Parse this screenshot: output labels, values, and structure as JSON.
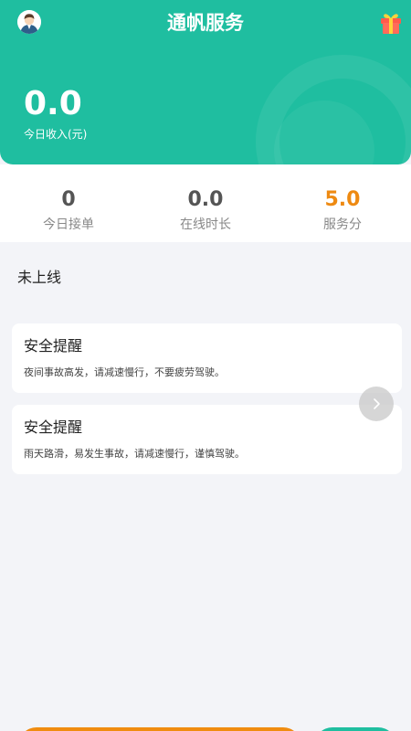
{
  "header": {
    "title": "通帆服务",
    "avatar_icon": "user-avatar-icon",
    "gift_icon": "gift-icon",
    "accent_color": "#1fbea0"
  },
  "income": {
    "value": "0.0",
    "label": "今日收入(元)"
  },
  "stats": [
    {
      "value": "0",
      "label": "今日接单"
    },
    {
      "value": "0.0",
      "label": "在线时长"
    },
    {
      "value": "5.0",
      "label": "服务分",
      "color": "#ee8a12"
    }
  ],
  "status": {
    "text": "未上线"
  },
  "notices": [
    {
      "title": "安全提醒",
      "text": "夜间事故高发，请减速慢行，不要疲劳驾驶。"
    },
    {
      "title": "安全提醒",
      "text": "雨天路滑，易发生事故，请减速慢行，谨慎驾驶。"
    }
  ],
  "controls": {
    "next_icon": "chevron-right-icon"
  }
}
